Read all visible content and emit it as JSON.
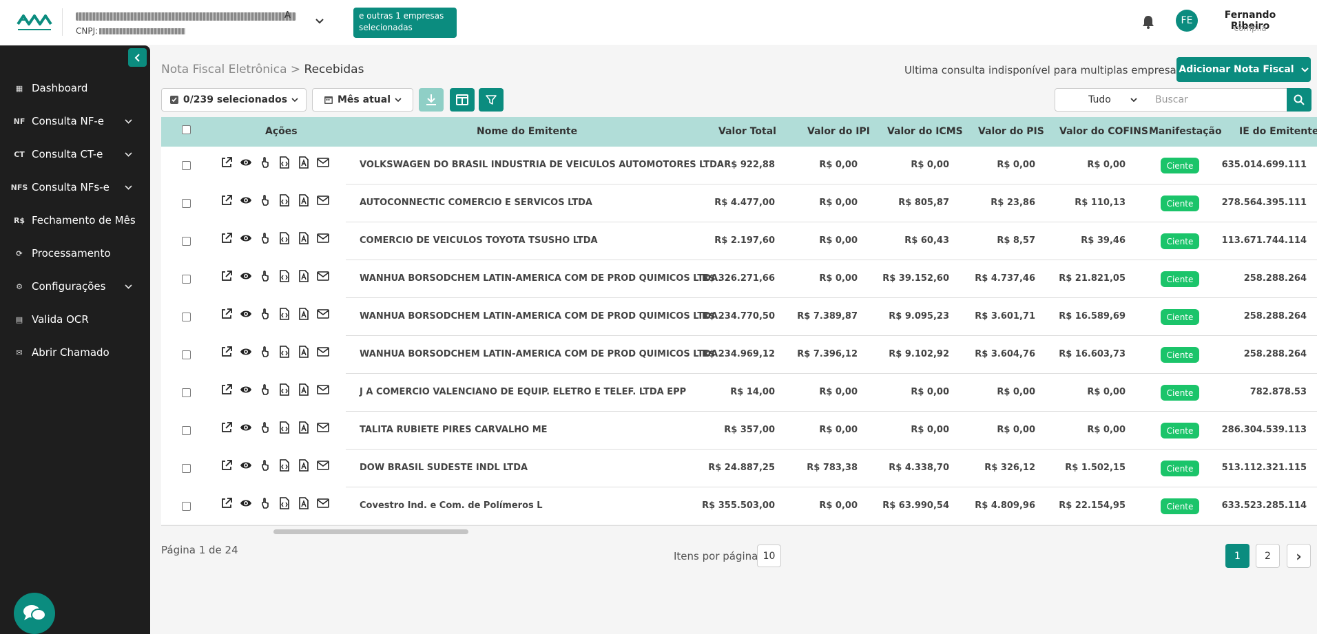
{
  "header": {
    "company_name_suffix": "A",
    "cnpj_label": "CNPJ:",
    "multi_badge": "e outras 1 empresas selecionadas",
    "user_initials": "FE",
    "user_name": "Fernando Ribeiro",
    "user_org": "compila"
  },
  "sidebar": {
    "items": [
      {
        "label": "Dashboard",
        "icon": "dashboard-icon",
        "glyph": "▦",
        "chevron": false
      },
      {
        "label": "Consulta NF-e",
        "icon": "nf-icon",
        "glyph": "NF",
        "chevron": true
      },
      {
        "label": "Consulta CT-e",
        "icon": "ct-icon",
        "glyph": "CT",
        "chevron": true
      },
      {
        "label": "Consulta NFs-e",
        "icon": "nfs-icon",
        "glyph": "NFS",
        "chevron": true
      },
      {
        "label": "Fechamento de Mês",
        "icon": "money-icon",
        "glyph": "R$",
        "chevron": false
      },
      {
        "label": "Processamento",
        "icon": "processing-icon",
        "glyph": "⟳",
        "chevron": false
      },
      {
        "label": "Configurações",
        "icon": "gear-icon",
        "glyph": "⚙",
        "chevron": true
      },
      {
        "label": "Valida OCR",
        "icon": "document-icon",
        "glyph": "▤",
        "chevron": false
      },
      {
        "label": "Abrir Chamado",
        "icon": "mail-icon",
        "glyph": "✉",
        "chevron": false
      }
    ]
  },
  "page": {
    "breadcrumb_parent": "Nota Fiscal Eletrônica",
    "breadcrumb_sep": ">",
    "breadcrumb_current": "Recebidas",
    "last_query": "Ultima consulta indisponível para multiplas empresas",
    "add_button": "Adicionar Nota Fiscal"
  },
  "toolbar": {
    "selection": "0/239 selecionados",
    "period": "Mês atual",
    "filter_select": "Tudo",
    "search_placeholder": "Buscar"
  },
  "table": {
    "headers": {
      "actions": "Ações",
      "issuer": "Nome do Emitente",
      "total": "Valor Total",
      "ipi": "Valor do IPI",
      "icms": "Valor do ICMS",
      "pis": "Valor do PIS",
      "cofins": "Valor do COFINS",
      "manifest": "Manifestação",
      "ie": "IE do Emitente"
    },
    "rows": [
      {
        "issuer": "VOLKSWAGEN DO BRASIL INDUSTRIA DE VEICULOS AUTOMOTORES LTDA",
        "total": "R$ 922,88",
        "ipi": "R$ 0,00",
        "icms": "R$ 0,00",
        "pis": "R$ 0,00",
        "cofins": "R$ 0,00",
        "manifest": "Ciente",
        "ie": "635.014.699.111"
      },
      {
        "issuer": "AUTOCONNECTIC COMERCIO E SERVICOS LTDA",
        "total": "R$ 4.477,00",
        "ipi": "R$ 0,00",
        "icms": "R$ 805,87",
        "pis": "R$ 23,86",
        "cofins": "R$ 110,13",
        "manifest": "Ciente",
        "ie": "278.564.395.111"
      },
      {
        "issuer": "COMERCIO DE VEICULOS TOYOTA TSUSHO LTDA",
        "total": "R$ 2.197,60",
        "ipi": "R$ 0,00",
        "icms": "R$ 60,43",
        "pis": "R$ 8,57",
        "cofins": "R$ 39,46",
        "manifest": "Ciente",
        "ie": "113.671.744.114"
      },
      {
        "issuer": "WANHUA BORSODCHEM LATIN-AMERICA COM DE PROD QUIMICOS LTDA.",
        "total": "R$ 326.271,66",
        "ipi": "R$ 0,00",
        "icms": "R$ 39.152,60",
        "pis": "R$ 4.737,46",
        "cofins": "R$ 21.821,05",
        "manifest": "Ciente",
        "ie": "258.288.264"
      },
      {
        "issuer": "WANHUA BORSODCHEM LATIN-AMERICA COM DE PROD QUIMICOS LTDA.",
        "total": "R$ 234.770,50",
        "ipi": "R$ 7.389,87",
        "icms": "R$ 9.095,23",
        "pis": "R$ 3.601,71",
        "cofins": "R$ 16.589,69",
        "manifest": "Ciente",
        "ie": "258.288.264"
      },
      {
        "issuer": "WANHUA BORSODCHEM LATIN-AMERICA COM DE PROD QUIMICOS LTDA.",
        "total": "R$ 234.969,12",
        "ipi": "R$ 7.396,12",
        "icms": "R$ 9.102,92",
        "pis": "R$ 3.604,76",
        "cofins": "R$ 16.603,73",
        "manifest": "Ciente",
        "ie": "258.288.264"
      },
      {
        "issuer": "J A COMERCIO VALENCIANO DE EQUIP. ELETRO E TELEF. LTDA EPP",
        "total": "R$ 14,00",
        "ipi": "R$ 0,00",
        "icms": "R$ 0,00",
        "pis": "R$ 0,00",
        "cofins": "R$ 0,00",
        "manifest": "Ciente",
        "ie": "782.878.53"
      },
      {
        "issuer": "TALITA RUBIETE PIRES CARVALHO ME",
        "total": "R$ 357,00",
        "ipi": "R$ 0,00",
        "icms": "R$ 0,00",
        "pis": "R$ 0,00",
        "cofins": "R$ 0,00",
        "manifest": "Ciente",
        "ie": "286.304.539.113"
      },
      {
        "issuer": "DOW BRASIL SUDESTE INDL LTDA",
        "total": "R$ 24.887,25",
        "ipi": "R$ 783,38",
        "icms": "R$ 4.338,70",
        "pis": "R$ 326,12",
        "cofins": "R$ 1.502,15",
        "manifest": "Ciente",
        "ie": "513.112.321.115"
      },
      {
        "issuer": "Covestro Ind. e Com. de Polímeros L",
        "total": "R$ 355.503,00",
        "ipi": "R$ 0,00",
        "icms": "R$ 63.990,54",
        "pis": "R$ 4.809,96",
        "cofins": "R$ 22.154,95",
        "manifest": "Ciente",
        "ie": "633.523.285.114"
      }
    ]
  },
  "pagination": {
    "page_info": "Página 1 de 24",
    "per_page_label": "Itens por página",
    "per_page_value": "10",
    "pages": [
      "1",
      "2"
    ],
    "next": "›"
  },
  "colors": {
    "accent": "#0b8c7f",
    "header_row": "#b1ddd8",
    "badge": "#1bc46a",
    "sidebar": "#1e1e1e"
  }
}
